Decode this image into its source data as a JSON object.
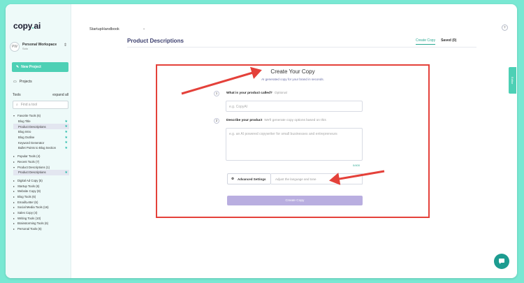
{
  "window": {
    "traffic_lights": [
      "close",
      "minimize",
      "maximize"
    ]
  },
  "sidebar": {
    "logo_text": "copy",
    "logo_dot": ".",
    "logo_ai": "ai",
    "workspace": {
      "initials": "PW",
      "name": "Personal Workspace",
      "sub": "Solo"
    },
    "new_project_label": "New Project",
    "projects_label": "Projects",
    "tools_label": "Tools",
    "expand_all_label": "expand all",
    "search_placeholder": "Find a tool",
    "tree": [
      {
        "label": "Favorite Tools (6)",
        "level": 0,
        "caret": "▾",
        "star": false,
        "selected": false
      },
      {
        "label": "Blog Title",
        "level": 1,
        "star": true,
        "selected": false
      },
      {
        "label": "Product Descriptions",
        "level": 1,
        "star": true,
        "selected": true
      },
      {
        "label": "Blog Intro",
        "level": 1,
        "star": true,
        "selected": false
      },
      {
        "label": "Blog Outline",
        "level": 1,
        "star": true,
        "selected": false
      },
      {
        "label": "Keyword Generator",
        "level": 1,
        "star": true,
        "selected": false
      },
      {
        "label": "Bullet Points to Blog Section",
        "level": 1,
        "star": true,
        "selected": false
      },
      {
        "label": "Popular Tools (4)",
        "level": 0,
        "caret": "▸",
        "star": false,
        "selected": false,
        "gap": true
      },
      {
        "label": "Recent Tools (7)",
        "level": 0,
        "caret": "▸",
        "star": false,
        "selected": false
      },
      {
        "label": "Product Descriptions (1)",
        "level": 0,
        "caret": "▾",
        "star": false,
        "selected": false
      },
      {
        "label": "Product Descriptions",
        "level": 1,
        "star": true,
        "selected": true
      },
      {
        "label": "Digital Ad Copy (5)",
        "level": 0,
        "caret": "▸",
        "star": false,
        "selected": false,
        "gap": true
      },
      {
        "label": "Startup Tools (6)",
        "level": 0,
        "caret": "▸",
        "star": false,
        "selected": false
      },
      {
        "label": "Website Copy (9)",
        "level": 0,
        "caret": "▸",
        "star": false,
        "selected": false
      },
      {
        "label": "Blog Tools (6)",
        "level": 0,
        "caret": "▸",
        "star": false,
        "selected": false
      },
      {
        "label": "Email/Letter (6)",
        "level": 0,
        "caret": "▸",
        "star": false,
        "selected": false
      },
      {
        "label": "Social Media Tools (16)",
        "level": 0,
        "caret": "▸",
        "star": false,
        "selected": false
      },
      {
        "label": "Sales Copy (4)",
        "level": 0,
        "caret": "▸",
        "star": false,
        "selected": false
      },
      {
        "label": "Writing Tools (10)",
        "level": 0,
        "caret": "▸",
        "star": false,
        "selected": false
      },
      {
        "label": "Brainstorming Tools (6)",
        "level": 0,
        "caret": "▸",
        "star": false,
        "selected": false
      },
      {
        "label": "Personal Tools (6)",
        "level": 0,
        "caret": "▸",
        "star": false,
        "selected": false
      }
    ]
  },
  "topbar": {
    "project_name": "StartupHandbook",
    "chevron": "⌄",
    "add_icon": "+"
  },
  "header": {
    "title": "Product Descriptions",
    "tab_create": "Create Copy",
    "tab_saved": "Saved (0)"
  },
  "panel": {
    "title": "Create Your Copy",
    "subtitle": "AI generated copy for your brand in seconds.",
    "q1": {
      "num": "1",
      "label": "What is your product called?",
      "hint": "Optional",
      "placeholder": "e.g. CopyAI"
    },
    "q2": {
      "num": "2",
      "label": "Describe your product",
      "hint": "We'll generate copy options based on this",
      "placeholder": "e.g. an AI powered copywriter for small businesses and entrepreneurs",
      "counter": "0/400"
    },
    "advanced_label": "Advanced Settings",
    "advanced_hint": "Adjust the language and tone",
    "create_label": "Create Copy"
  },
  "side_tab_label": "Editor",
  "colors": {
    "accent": "#4dd0b5",
    "highlight": "#e4413a",
    "button_disabled": "#b9aee0",
    "background": "#79e8d3"
  }
}
